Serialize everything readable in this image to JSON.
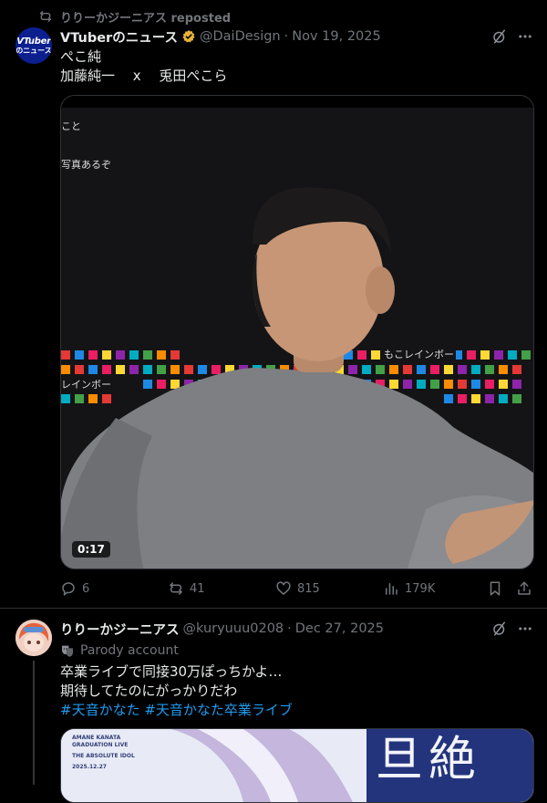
{
  "tweet1": {
    "repost_label": "りりーかジーニアス reposted",
    "avatar_text_line1": "VTuber",
    "avatar_text_line2": "のニュース",
    "display_name": "VTuberのニュース",
    "handle": "@DaiDesign",
    "dot": "·",
    "date": "Nov 19, 2025",
    "text_line1": "ぺこ純",
    "text_line2": "加藤純一　 x　 兎田ぺこら",
    "video": {
      "duration": "0:17",
      "overlay_text": [
        "こと",
        "写真あるぞ",
        "もこレインボー",
        "レインボー"
      ]
    },
    "actions": {
      "replies": "6",
      "reposts": "41",
      "likes": "815",
      "views": "179K"
    },
    "colors": {
      "verified": "#e8b33a",
      "accent": "#1d9bf0"
    }
  },
  "tweet2": {
    "display_name": "りりーかジーニアス",
    "handle": "@kuryuuu0208",
    "dot": "·",
    "date": "Dec 27, 2025",
    "parody_label": "Parody account",
    "text_line1": "卒業ライブで同接30万ぽっちかよ…",
    "text_line2": "期待してたのにがっかりだわ",
    "hashtag1": "#天音かなた",
    "hashtag2": "#天音かなた卒業ライブ",
    "media": {
      "line1": "AMANE KANATA",
      "line2": "GRADUATION LIVE",
      "line3": "THE ABSOLUTE IDOL",
      "line4": "2025.12.27",
      "title_glyphs": "旦絶"
    }
  }
}
